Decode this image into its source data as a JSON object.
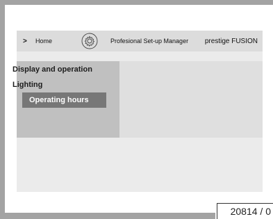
{
  "nav": {
    "arrow": ">",
    "home": "Home",
    "settings_icon": "gear-icon",
    "title": "Profesional Set-up Manager",
    "brand": "prestige FUSION"
  },
  "menu": {
    "items": [
      {
        "label": "Display and operation",
        "selected": false
      },
      {
        "label": "Lighting",
        "selected": false
      },
      {
        "label": "Operating hours",
        "selected": true
      }
    ]
  },
  "reference": "20814 / 0",
  "colors": {
    "screen_bg": "#ebebeb",
    "nav_bg": "#dcdcdc",
    "menu_bg": "#c0c0c0",
    "selected_bg": "#777777",
    "frame": "#a3a3a3"
  }
}
